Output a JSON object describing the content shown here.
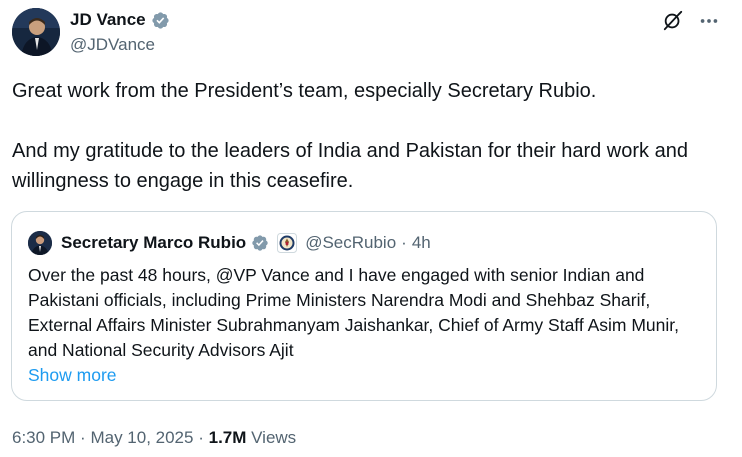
{
  "author": {
    "name": "JD Vance",
    "handle": "@JDVance"
  },
  "tweet": {
    "paragraphs": [
      "Great work from the President’s team, especially Secretary Rubio.",
      "And my gratitude to the leaders of India and Pakistan for their hard work and willingness to engage in this ceasefire."
    ]
  },
  "quote": {
    "name": "Secretary Marco Rubio",
    "handle": "@SecRubio",
    "separator": "·",
    "time": "4h",
    "text": "Over the past 48 hours, @VP Vance and I have engaged with senior Indian and Pakistani officials, including Prime Ministers Narendra Modi and Shehbaz Sharif, External Affairs Minister Subrahmanyam Jaishankar, Chief of Army Staff Asim Munir, and National Security Advisors Ajit",
    "show_more": "Show more"
  },
  "meta": {
    "time": "6:30 PM",
    "separator": "·",
    "date": "May 10, 2025",
    "views_count": "1.7M",
    "views_label": "Views"
  },
  "icons": {
    "verified": "verified-badge-icon",
    "grok": "grok-icon",
    "more": "more-options-icon",
    "seal": "government-seal-icon"
  },
  "colors": {
    "text": "#0f1419",
    "secondary": "#536471",
    "link": "#1d9bf0",
    "border": "#cfd9de",
    "verified_blue": "#1d9bf0",
    "verified_gray": "#829aab"
  }
}
